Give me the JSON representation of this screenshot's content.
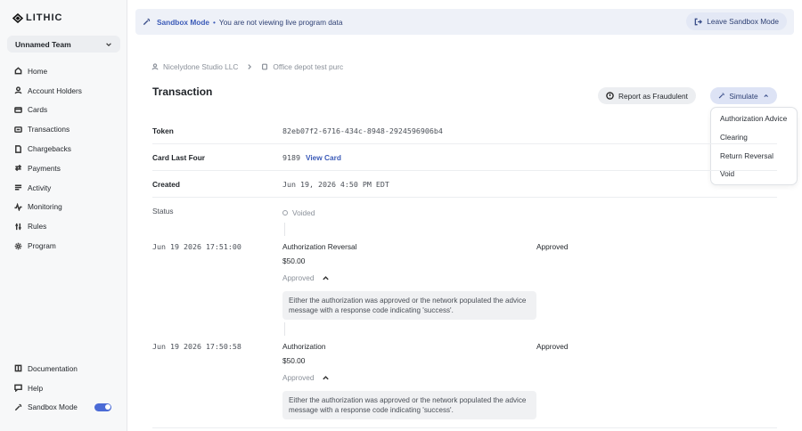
{
  "sidebar": {
    "logo": "LITHIC",
    "team": "Unnamed Team",
    "nav": [
      {
        "label": "Home",
        "icon": "home-icon"
      },
      {
        "label": "Account Holders",
        "icon": "user-icon"
      },
      {
        "label": "Cards",
        "icon": "card-icon"
      },
      {
        "label": "Transactions",
        "icon": "transactions-icon"
      },
      {
        "label": "Chargebacks",
        "icon": "document-icon"
      },
      {
        "label": "Payments",
        "icon": "arrows-icon"
      },
      {
        "label": "Activity",
        "icon": "list-icon"
      },
      {
        "label": "Monitoring",
        "icon": "pulse-icon"
      },
      {
        "label": "Rules",
        "icon": "sliders-icon"
      },
      {
        "label": "Program",
        "icon": "gear-icon"
      }
    ],
    "bottom": [
      {
        "label": "Documentation",
        "icon": "book-icon"
      },
      {
        "label": "Help",
        "icon": "chat-icon"
      },
      {
        "label": "Sandbox Mode",
        "icon": "wand-icon"
      }
    ]
  },
  "banner": {
    "mode": "Sandbox Mode",
    "separator": "•",
    "message": "You are not viewing live program data",
    "leave_label": "Leave Sandbox Mode"
  },
  "breadcrumb": {
    "first": "Nicelydone Studio LLC",
    "second": "Office depot test purc"
  },
  "page": {
    "title": "Transaction",
    "report_label": "Report as Fraudulent",
    "simulate_label": "Simulate"
  },
  "simulate_menu": [
    "Authorization Advice",
    "Clearing",
    "Return Reversal",
    "Void"
  ],
  "details": {
    "token_label": "Token",
    "token_value": "82eb07f2-6716-434c-8948-2924596906b4",
    "card_label": "Card Last Four",
    "card_value": "9189",
    "view_card": "View Card",
    "created_label": "Created",
    "created_value": "Jun 19, 2026 4:50 PM EDT",
    "status_label": "Status",
    "status_value": "Voided"
  },
  "events": [
    {
      "time": "Jun 19 2026 17:51:00",
      "type": "Authorization Reversal",
      "status": "Approved",
      "amount": "$50.00",
      "result": "Approved",
      "description": "Either the authorization was approved or the network populated the advice message with a response code indicating 'success'."
    },
    {
      "time": "Jun 19 2026 17:50:58",
      "type": "Authorization",
      "status": "Approved",
      "amount": "$50.00",
      "result": "Approved",
      "description": "Either the authorization was approved or the network populated the advice message with a response code indicating 'success'."
    }
  ],
  "colors": {
    "accent": "#3c5bb8",
    "banner_bg": "#eef1f8",
    "sidebar_bg": "#f7f8f9",
    "toggle_on": "#4b6bd6"
  }
}
